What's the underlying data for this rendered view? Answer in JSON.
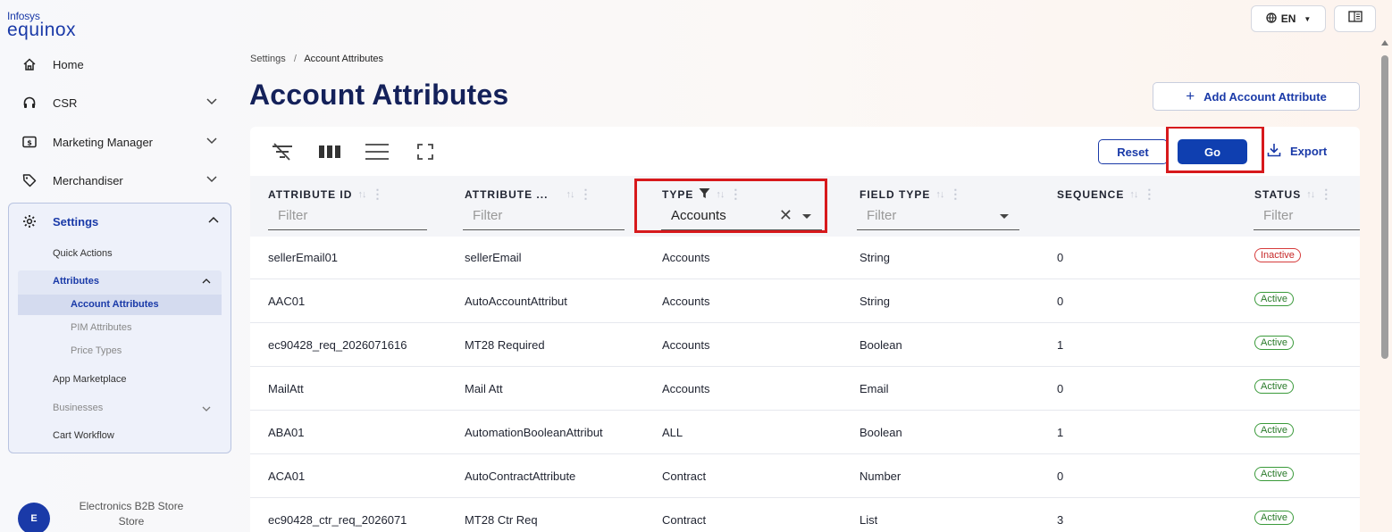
{
  "logo": {
    "line1": "Infosys",
    "line2": "equinox"
  },
  "sidebar": {
    "items": [
      {
        "label": "Home",
        "icon": "home-icon"
      },
      {
        "label": "CSR",
        "icon": "headset-icon"
      },
      {
        "label": "Marketing Manager",
        "icon": "dollar-icon"
      },
      {
        "label": "Merchandiser",
        "icon": "tag-icon"
      }
    ],
    "settings": {
      "label": "Settings",
      "icon": "gear-icon",
      "subitems": {
        "quick_actions": "Quick Actions",
        "attributes": "Attributes",
        "account_attributes": "Account Attributes",
        "pim_attributes": "PIM Attributes",
        "price_types": "Price Types",
        "app_marketplace": "App Marketplace",
        "businesses": "Businesses",
        "cart_workflow": "Cart Workflow"
      }
    },
    "store": {
      "avatar": "E",
      "line1": "Electronics B2B Store",
      "line2": "Store"
    }
  },
  "topbar": {
    "lang": "EN"
  },
  "breadcrumb": {
    "parent": "Settings",
    "sep": "/",
    "current": "Account Attributes"
  },
  "page_title": "Account Attributes",
  "add_button": "Add Account Attribute",
  "toolbar": {
    "reset": "Reset",
    "go": "Go",
    "export": "Export"
  },
  "columns": [
    {
      "label": "ATTRIBUTE ID",
      "filter": "Filter"
    },
    {
      "label": "ATTRIBUTE ...",
      "filter": "Filter"
    },
    {
      "label": "TYPE",
      "filter": "Accounts"
    },
    {
      "label": "FIELD TYPE",
      "filter": "Filter"
    },
    {
      "label": "SEQUENCE",
      "filter": ""
    },
    {
      "label": "STATUS",
      "filter": "Filter"
    }
  ],
  "rows": [
    {
      "id": "sellerEmail01",
      "name": "sellerEmail",
      "type": "Accounts",
      "field_type": "String",
      "sequence": "0",
      "status": "Inactive"
    },
    {
      "id": "AAC01",
      "name": "AutoAccountAttribut",
      "type": "Accounts",
      "field_type": "String",
      "sequence": "0",
      "status": "Active"
    },
    {
      "id": "ec90428_req_2026071616",
      "name": "MT28 Required",
      "type": "Accounts",
      "field_type": "Boolean",
      "sequence": "1",
      "status": "Active"
    },
    {
      "id": "MailAtt",
      "name": "Mail Att",
      "type": "Accounts",
      "field_type": "Email",
      "sequence": "0",
      "status": "Active"
    },
    {
      "id": "ABA01",
      "name": "AutomationBooleanAttribut",
      "type": "ALL",
      "field_type": "Boolean",
      "sequence": "1",
      "status": "Active"
    },
    {
      "id": "ACA01",
      "name": "AutoContractAttribute",
      "type": "Contract",
      "field_type": "Number",
      "sequence": "0",
      "status": "Active"
    },
    {
      "id": "ec90428_ctr_req_2026071",
      "name": "MT28 Ctr Req",
      "type": "Contract",
      "field_type": "List",
      "sequence": "3",
      "status": "Active"
    }
  ]
}
